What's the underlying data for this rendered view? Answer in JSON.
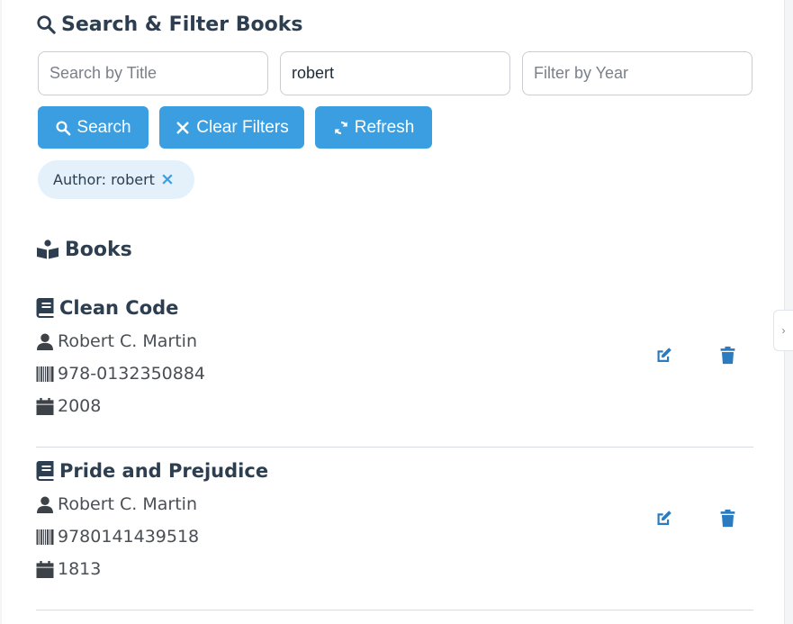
{
  "header": {
    "title": "Search & Filter Books"
  },
  "filters": {
    "title_placeholder": "Search by Title",
    "author_value": "robert",
    "year_placeholder": "Filter by Year"
  },
  "buttons": {
    "search_label": "Search",
    "clear_label": "Clear Filters",
    "refresh_label": "Refresh"
  },
  "active_filter": {
    "label": "Author: robert",
    "remove_symbol": "×"
  },
  "books_section": {
    "title": "Books"
  },
  "books": [
    {
      "title": "Clean Code",
      "author": "Robert C. Martin",
      "isbn": "978-0132350884",
      "year": "2008"
    },
    {
      "title": "Pride and Prejudice",
      "author": "Robert C. Martin",
      "isbn": "9780141439518",
      "year": "1813"
    }
  ],
  "colors": {
    "accent": "#3a9ee0",
    "chip_bg": "#e4f1fb",
    "heading": "#2c3e50",
    "action_icon": "#2b7bc0"
  },
  "icons": {
    "title": "magnifying-glass-icon",
    "section": "book-reader-icon",
    "book": "book-icon",
    "author": "user-icon",
    "isbn": "barcode-icon",
    "year": "calendar-icon",
    "edit": "edit-icon",
    "delete": "trash-icon"
  }
}
